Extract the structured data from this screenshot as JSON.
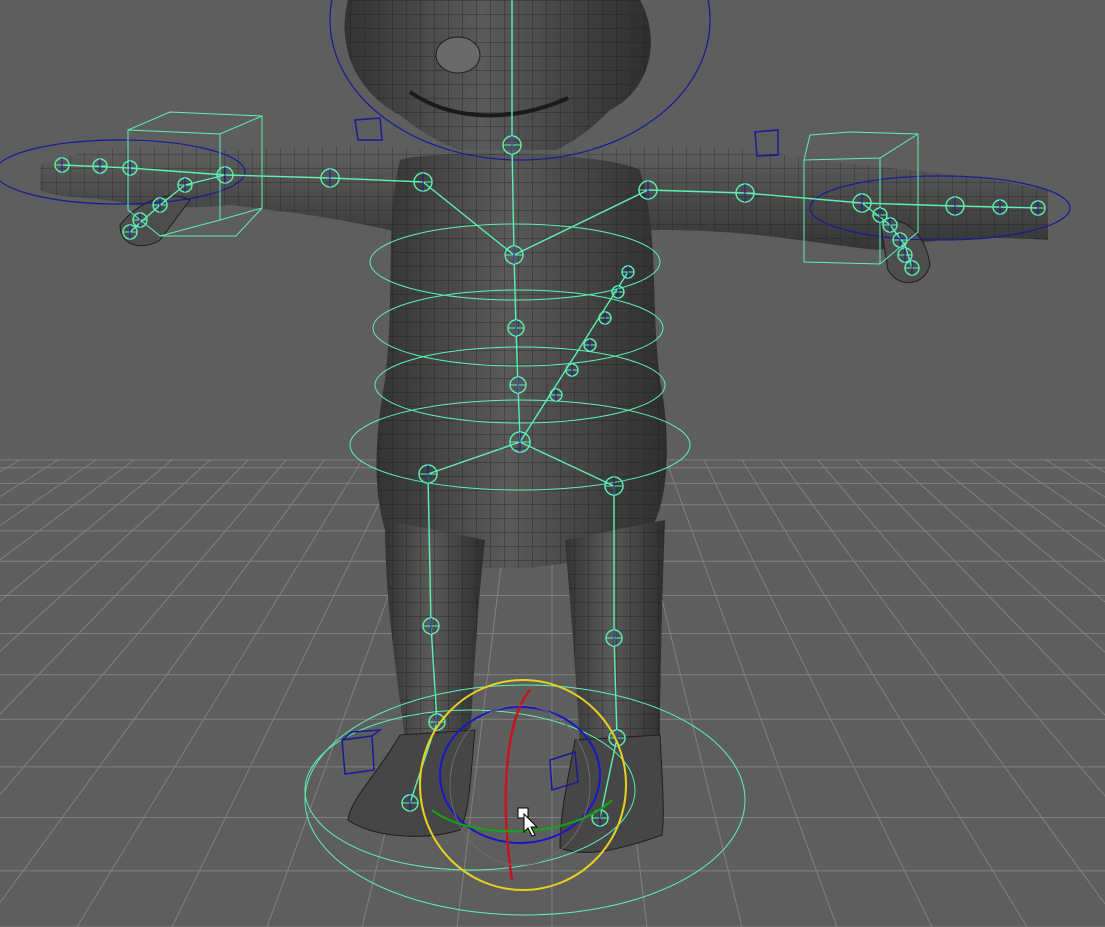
{
  "viewport": {
    "background": "#5e5e5e",
    "grid_color": "#808080",
    "mesh_fill": "#4a4a4a",
    "mesh_wire": "#1e1e1e",
    "joint_color": "#5cf0b4",
    "locator_color": "#1a1a9a",
    "rotate_x_color": "#c8121e",
    "rotate_y_color": "#12a812",
    "rotate_z_color": "#1818c8",
    "rotate_outer_color": "#e8d020"
  },
  "scene": {
    "character": "rigged-character",
    "tool": "rotate-manipulator",
    "cursor": "arrow-pointer"
  }
}
